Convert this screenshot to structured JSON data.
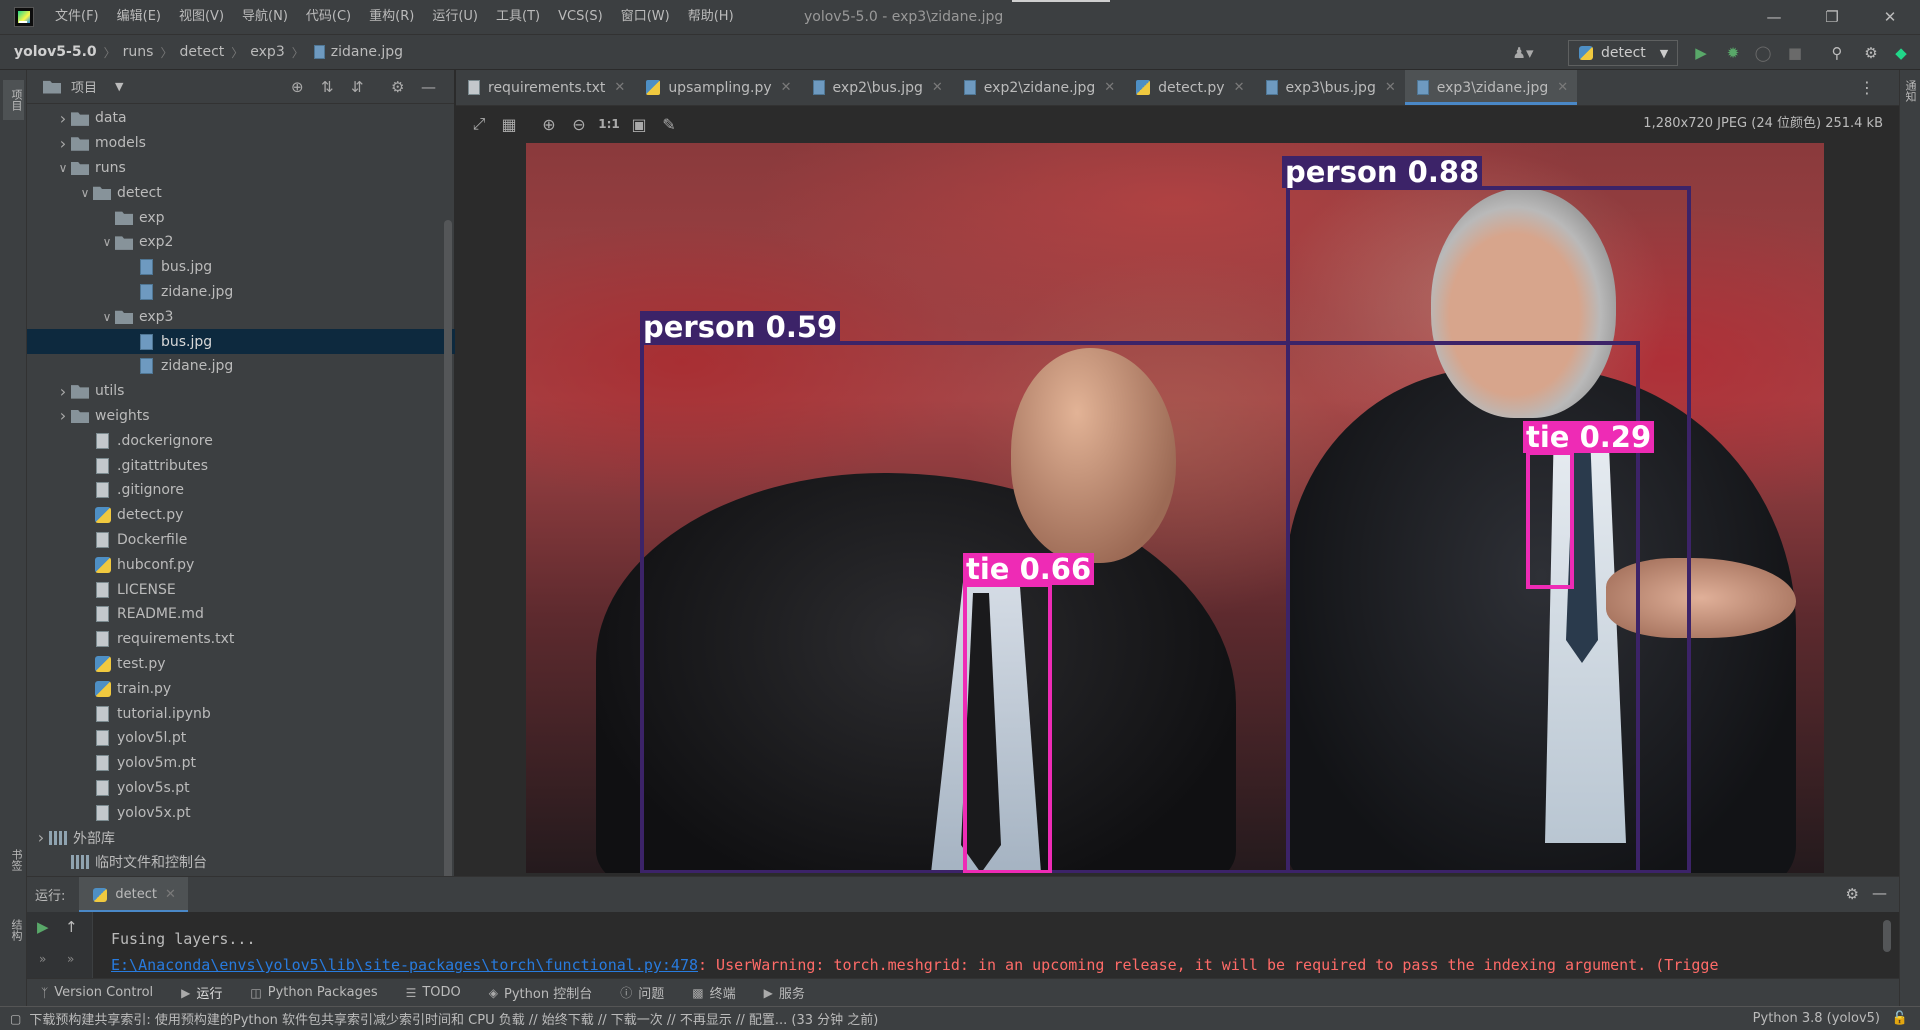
{
  "titlebar": {
    "menu": [
      "文件(F)",
      "编辑(E)",
      "视图(V)",
      "导航(N)",
      "代码(C)",
      "重构(R)",
      "运行(U)",
      "工具(T)",
      "VCS(S)",
      "窗口(W)",
      "帮助(H)"
    ],
    "window_title": "yolov5-5.0 - exp3\\zidane.jpg"
  },
  "navbar": {
    "breadcrumbs": [
      "yolov5-5.0",
      "runs",
      "detect",
      "exp3",
      "zidane.jpg"
    ],
    "run_config": "detect"
  },
  "project": {
    "header_label": "项目",
    "tree": [
      {
        "label": "data",
        "depth": 1,
        "kind": "folder",
        "expanded": false
      },
      {
        "label": "models",
        "depth": 1,
        "kind": "folder",
        "expanded": false
      },
      {
        "label": "runs",
        "depth": 1,
        "kind": "folder",
        "expanded": true
      },
      {
        "label": "detect",
        "depth": 2,
        "kind": "folder",
        "expanded": true
      },
      {
        "label": "exp",
        "depth": 3,
        "kind": "folder",
        "expanded": null
      },
      {
        "label": "exp2",
        "depth": 3,
        "kind": "folder",
        "expanded": true
      },
      {
        "label": "bus.jpg",
        "depth": 4,
        "kind": "image"
      },
      {
        "label": "zidane.jpg",
        "depth": 4,
        "kind": "image"
      },
      {
        "label": "exp3",
        "depth": 3,
        "kind": "folder",
        "expanded": true
      },
      {
        "label": "bus.jpg",
        "depth": 4,
        "kind": "image",
        "selected": true
      },
      {
        "label": "zidane.jpg",
        "depth": 4,
        "kind": "image"
      },
      {
        "label": "utils",
        "depth": 1,
        "kind": "folder",
        "expanded": false
      },
      {
        "label": "weights",
        "depth": 1,
        "kind": "folder",
        "expanded": false
      },
      {
        "label": ".dockerignore",
        "depth": 2,
        "kind": "file"
      },
      {
        "label": ".gitattributes",
        "depth": 2,
        "kind": "file"
      },
      {
        "label": ".gitignore",
        "depth": 2,
        "kind": "file"
      },
      {
        "label": "detect.py",
        "depth": 2,
        "kind": "py"
      },
      {
        "label": "Dockerfile",
        "depth": 2,
        "kind": "file"
      },
      {
        "label": "hubconf.py",
        "depth": 2,
        "kind": "py"
      },
      {
        "label": "LICENSE",
        "depth": 2,
        "kind": "file"
      },
      {
        "label": "README.md",
        "depth": 2,
        "kind": "file"
      },
      {
        "label": "requirements.txt",
        "depth": 2,
        "kind": "file"
      },
      {
        "label": "test.py",
        "depth": 2,
        "kind": "py"
      },
      {
        "label": "train.py",
        "depth": 2,
        "kind": "py"
      },
      {
        "label": "tutorial.ipynb",
        "depth": 2,
        "kind": "file"
      },
      {
        "label": "yolov5l.pt",
        "depth": 2,
        "kind": "file"
      },
      {
        "label": "yolov5m.pt",
        "depth": 2,
        "kind": "file"
      },
      {
        "label": "yolov5s.pt",
        "depth": 2,
        "kind": "file"
      },
      {
        "label": "yolov5x.pt",
        "depth": 2,
        "kind": "file"
      },
      {
        "label": "外部库",
        "depth": 0,
        "kind": "lib",
        "expanded": false
      },
      {
        "label": "临时文件和控制台",
        "depth": 1,
        "kind": "lib"
      }
    ]
  },
  "left_stripe": {
    "top_label": "项目",
    "bottom_label_1": "书签",
    "bottom_label_2": "结构"
  },
  "right_stripe": {
    "label": "通知"
  },
  "editor": {
    "tabs": [
      {
        "label": "requirements.txt",
        "icon": "txt"
      },
      {
        "label": "upsampling.py",
        "icon": "py"
      },
      {
        "label": "exp2\\bus.jpg",
        "icon": "img"
      },
      {
        "label": "exp2\\zidane.jpg",
        "icon": "img"
      },
      {
        "label": "detect.py",
        "icon": "py"
      },
      {
        "label": "exp3\\bus.jpg",
        "icon": "img"
      },
      {
        "label": "exp3\\zidane.jpg",
        "icon": "img",
        "active": true
      }
    ],
    "image_info": "1,280x720 JPEG (24 位颜色) 251.4 kB"
  },
  "detections": [
    {
      "label": "person 0.88",
      "color": "#3c2368"
    },
    {
      "label": "person 0.59",
      "color": "#3c2368"
    },
    {
      "label": "tie 0.29",
      "color": "#ee2bb5"
    },
    {
      "label": "tie 0.66",
      "color": "#ee2bb5"
    }
  ],
  "run": {
    "prefix": "运行:",
    "tab_label": "detect",
    "console_line_1": "Fusing layers...",
    "console_link": "E:\\Anaconda\\envs\\yolov5\\lib\\site-packages\\torch\\functional.py:478",
    "console_warning": ": UserWarning: torch.meshgrid: in an upcoming release, it will be required to pass the indexing argument. (Trigge"
  },
  "bottom_tools": [
    "Version Control",
    "运行",
    "Python Packages",
    "TODO",
    "Python 控制台",
    "问题",
    "终端",
    "服务"
  ],
  "statusbar": {
    "message": "下载预构建共享索引: 使用预构建的Python 软件包共享索引减少索引时间和 CPU 负载 // 始终下载 // 下载一次 // 不再显示 // 配置... (33 分钟 之前)",
    "interpreter": "Python 3.8 (yolov5)"
  },
  "colors": {
    "accent": "#4a88c7",
    "person_box": "#3c2368",
    "tie_box": "#ee2bb5"
  }
}
